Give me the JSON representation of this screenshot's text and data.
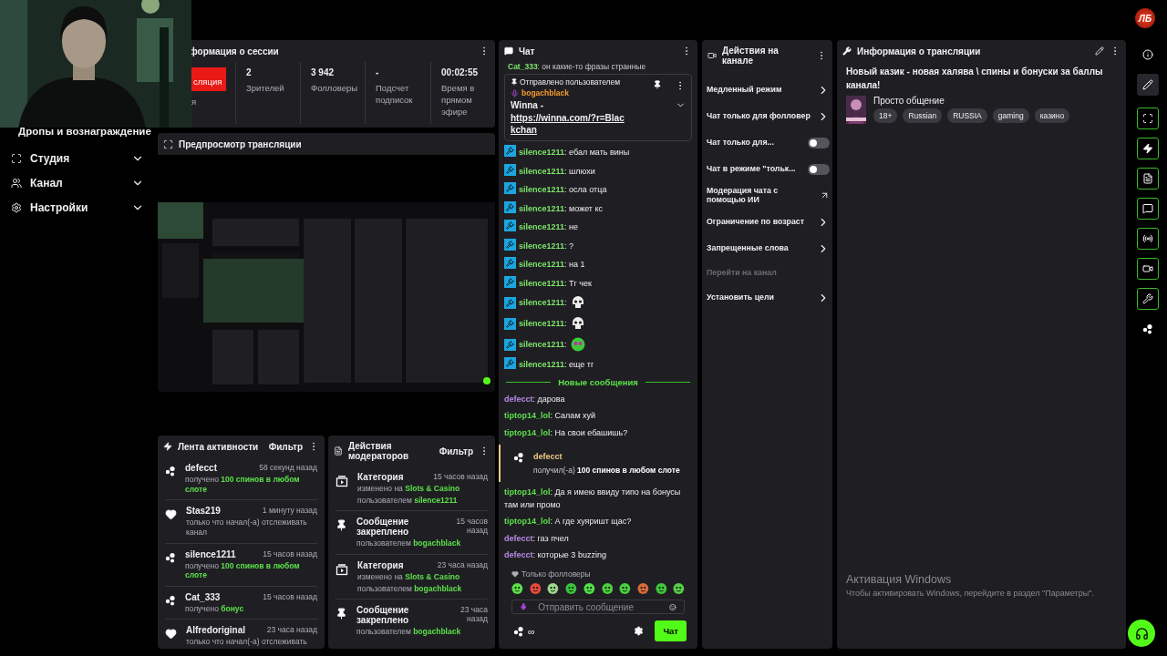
{
  "top_bar": {
    "logo": "ЛБ"
  },
  "sidebar": {
    "partial_item": "Дропы и вознаграждение",
    "items": [
      {
        "kind": "studio",
        "label": "Студия",
        "expanded": false
      },
      {
        "kind": "channel",
        "label": "Канал",
        "expanded": false
      },
      {
        "kind": "settings",
        "label": "Настройки",
        "expanded": false
      }
    ]
  },
  "session": {
    "title": "формация о сессии",
    "live_badge": "сляция",
    "live_caption": "я",
    "stats": [
      {
        "value": "2",
        "label": "Зрителей"
      },
      {
        "value": "3 942",
        "label": "Фолловеры"
      },
      {
        "value": "-",
        "label": "Подсчет подписок"
      },
      {
        "value": "00:02:55",
        "label": "Время в прямом эфире"
      }
    ]
  },
  "preview": {
    "title": "Предпросмотр трансляции",
    "kind": "picture"
  },
  "activity": {
    "title": "Лента активности",
    "filter": "Фильтр",
    "items": [
      {
        "kind": "reward",
        "user": "defecct",
        "time": "58 секунд назад",
        "text": "получено **100 спинов в любом слоте**"
      },
      {
        "kind": "follow",
        "user": "Stas219",
        "time": "1 минуту назад",
        "text": "только что начал(-а) отслеживать канал"
      },
      {
        "kind": "reward",
        "user": "silence1211",
        "time": "15 часов назад",
        "text": "получено **100 спинов в любом слоте**"
      },
      {
        "kind": "reward",
        "user": "Cat_333",
        "time": "15 часов назад",
        "text": "получено **бонус**"
      },
      {
        "kind": "follow",
        "user": "Alfredoriginal",
        "time": "23 часа назад",
        "text": "только что начал(-а) отслеживать"
      }
    ]
  },
  "mod_actions": {
    "title": "Действия модераторов",
    "filter": "Фильтр",
    "items": [
      {
        "kind": "category",
        "title": "Категория",
        "time": "15 часов назад",
        "lines": [
          "изменено на **Slots & Casino**",
          "пользователем **silence1211**"
        ]
      },
      {
        "kind": "pin",
        "title": "Сообщение закреплено",
        "time": "15 часов назад",
        "lines": [
          "пользователем **bogachblack**"
        ]
      },
      {
        "kind": "category",
        "title": "Категория",
        "time": "23 часа назад",
        "lines": [
          "изменено на **Slots & Casino**",
          "пользователем **bogachblack**"
        ]
      },
      {
        "kind": "pin",
        "title": "Сообщение закреплено",
        "time": "23 часа назад",
        "lines": [
          "пользователем **bogachblack**"
        ]
      }
    ]
  },
  "chat": {
    "title": "Чат",
    "cut_message": {
      "user": "Cat_333",
      "text": ": он какие-то фразы странные"
    },
    "pinned": {
      "caption": "Отправлено пользователем",
      "user": "bogachblack",
      "text": "Winna - ",
      "link": "https://winna.com/?r=Blackchan"
    },
    "messages": [
      {
        "kind": "text",
        "user": "silence1211",
        "color": "#7ee36a",
        "moderator": true,
        "text": ": ебал мать вины"
      },
      {
        "kind": "text",
        "user": "silence1211",
        "color": "#7ee36a",
        "moderator": true,
        "text": ": шлюхи"
      },
      {
        "kind": "text",
        "user": "silence1211",
        "color": "#7ee36a",
        "moderator": true,
        "text": ": осла отца"
      },
      {
        "kind": "text",
        "user": "silence1211",
        "color": "#7ee36a",
        "moderator": true,
        "text": ": может кс"
      },
      {
        "kind": "text",
        "user": "silence1211",
        "color": "#7ee36a",
        "moderator": true,
        "text": ": не"
      },
      {
        "kind": "text",
        "user": "silence1211",
        "color": "#7ee36a",
        "moderator": true,
        "text": ": ?"
      },
      {
        "kind": "text",
        "user": "silence1211",
        "color": "#7ee36a",
        "moderator": true,
        "text": ": на 1"
      },
      {
        "kind": "text",
        "user": "silence1211",
        "color": "#7ee36a",
        "moderator": true,
        "text": ": Тг чек"
      },
      {
        "kind": "emote",
        "user": "silence1211",
        "color": "#7ee36a",
        "moderator": true,
        "text": ":"
      },
      {
        "kind": "emote",
        "user": "silence1211",
        "color": "#7ee36a",
        "moderator": true,
        "text": ":"
      },
      {
        "kind": "emote",
        "user": "silence1211",
        "color": "#7ee36a",
        "moderator": true,
        "text": ":"
      },
      {
        "kind": "text",
        "user": "silence1211",
        "color": "#7ee36a",
        "moderator": true,
        "text": ": еще тг"
      },
      {
        "kind": "divider",
        "text": "Новые сообщения"
      },
      {
        "kind": "text",
        "user": "defecct",
        "color": "#b98be8",
        "moderator": false,
        "text": ": дарова"
      },
      {
        "kind": "text",
        "user": "tiptop14_lol",
        "color": "#5ce04a",
        "moderator": false,
        "text": ": Салам хуй"
      },
      {
        "kind": "text",
        "user": "tiptop14_lol",
        "color": "#5ce04a",
        "moderator": false,
        "text": ": На свои ебашишь?"
      },
      {
        "kind": "reward",
        "user": "defecct",
        "color": "#f0c987",
        "text": "получил(-а) **100 спинов в любом слоте**"
      },
      {
        "kind": "text",
        "user": "tiptop14_lol",
        "color": "#5ce04a",
        "moderator": false,
        "text": ": Да я имею ввиду типо на бонусы там или промо"
      },
      {
        "kind": "text",
        "user": "tiptop14_lol",
        "color": "#5ce04a",
        "moderator": false,
        "text": ": А где хуяришт щас?"
      },
      {
        "kind": "text",
        "user": "defecct",
        "color": "#b98be8",
        "moderator": false,
        "text": ": газ пчел"
      },
      {
        "kind": "text",
        "user": "defecct",
        "color": "#b98be8",
        "moderator": false,
        "text": ": которые 3 buzzing"
      }
    ],
    "followers_only": "Только фолловеры",
    "input": {
      "placeholder": "Отправить сообщение"
    },
    "points": "∞",
    "send": "Чат"
  },
  "actions": {
    "title": "Действия на канале",
    "items": [
      {
        "kind": "chevron",
        "label": "Медленный режим",
        "disabled": false
      },
      {
        "kind": "chevron",
        "label": "Чат только для фолловер",
        "disabled": false
      },
      {
        "kind": "toggle",
        "label": "Чат только для...",
        "on": false,
        "disabled": false
      },
      {
        "kind": "toggle",
        "label": "Чат в режиме \"тольк...",
        "on": false,
        "disabled": false
      },
      {
        "kind": "external",
        "label": "Модерация чата с помощью ИИ",
        "disabled": false
      },
      {
        "kind": "chevron",
        "label": "Ограничение по возраст",
        "disabled": false
      },
      {
        "kind": "chevron",
        "label": "Запрещенные слова",
        "disabled": false
      },
      {
        "kind": "plain",
        "label": "Перейти на канал",
        "disabled": true
      },
      {
        "kind": "chevron",
        "label": "Установить цели",
        "disabled": false
      }
    ]
  },
  "stream_info": {
    "title": "Информация о трансляции",
    "stream_title": "Новый казик - новая халява \\ спины и бонуски за баллы канала!",
    "category": "Просто общение",
    "tags": [
      "18+",
      "Russian",
      "RUSSIA",
      "gaming",
      "казино"
    ]
  },
  "rail": {
    "items": [
      {
        "kind": "info",
        "on": false
      },
      {
        "kind": "edit",
        "on": false
      },
      {
        "kind": "capture",
        "on": true
      },
      {
        "kind": "bolt",
        "on": true
      },
      {
        "kind": "document",
        "on": true
      },
      {
        "kind": "chat",
        "on": true
      },
      {
        "kind": "broadcast",
        "on": true
      },
      {
        "kind": "camera",
        "on": true
      },
      {
        "kind": "wrench",
        "on": true
      },
      {
        "kind": "dots",
        "on": false
      }
    ]
  },
  "watermark": {
    "title": "Активация Windows",
    "text": "Чтобы активировать Windows, перейдите в раздел \"Параметры\"."
  }
}
